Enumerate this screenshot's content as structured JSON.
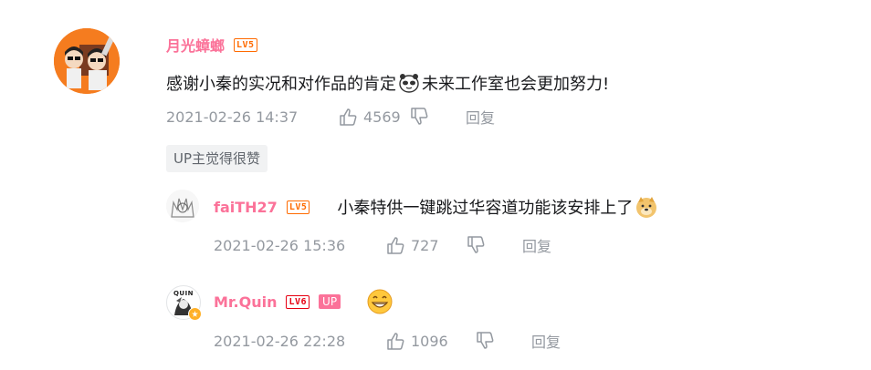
{
  "comment_main": {
    "username": "月光蟑螂",
    "level": "LV5",
    "text_part1": "感谢小秦的实况和对作品的肯定",
    "text_part2": "未来工作室也会更加努力!",
    "timestamp": "2021-02-26 14:37",
    "likes": "4569",
    "reply_label": "回复",
    "up_liked_tag": "UP主觉得很赞"
  },
  "reply_1": {
    "username": "faiTH27",
    "level": "LV5",
    "text": "小秦特供一键跳过华容道功能该安排上了",
    "timestamp": "2021-02-26 15:36",
    "likes": "727",
    "reply_label": "回复"
  },
  "reply_2": {
    "username": "Mr.Quin",
    "level": "LV6",
    "up_badge": "UP",
    "avatar_text": "QUIN",
    "timestamp": "2021-02-26 22:28",
    "likes": "1096",
    "reply_label": "回复"
  },
  "colors": {
    "username": "#fb7299",
    "level5": "#ff6a00",
    "level6": "#e60012",
    "meta": "#9499a0",
    "avatar_bg": "#f57c1f"
  }
}
